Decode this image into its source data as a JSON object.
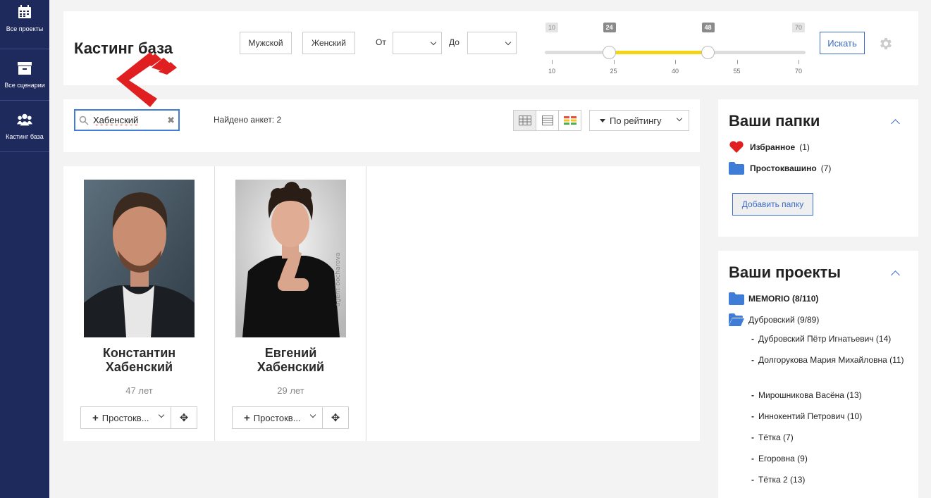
{
  "sidebar": {
    "items": [
      {
        "label": "Все проекты",
        "icon": "calendar-icon"
      },
      {
        "label": "Все сценарии",
        "icon": "archive-icon"
      },
      {
        "label": "Кастинг база",
        "icon": "users-icon"
      }
    ]
  },
  "header": {
    "title": "Кастинг база",
    "male_label": "Мужской",
    "female_label": "Женский",
    "from_label": "От",
    "to_label": "До",
    "search_label": "Искать"
  },
  "age_slider": {
    "min": 10,
    "max": 70,
    "low": 24,
    "high": 48,
    "min_label": "10",
    "max_label": "70",
    "low_label": "24",
    "high_label": "48",
    "ticks": [
      "10",
      "25",
      "40",
      "55",
      "70"
    ]
  },
  "filter": {
    "search_value": "Хабенский",
    "found_text": "Найдено анкет: 2",
    "sort_label": "По рейтингу"
  },
  "cards": [
    {
      "first": "Константин",
      "last": "Хабенский",
      "age": "47 лет",
      "folder": "Простоквашино",
      "folder_short": "Простоквашино",
      "folder_display": "Простокв..."
    },
    {
      "first": "Евгений",
      "last": "Хабенский",
      "age": "29 лет",
      "folder": "Простоквашино",
      "folder_display": "Простокв..."
    }
  ],
  "folders_panel": {
    "title": "Ваши папки",
    "items": [
      {
        "name": "Избранное",
        "count": "(1)",
        "icon": "heart-icon"
      },
      {
        "name": "Простоквашино",
        "count": "(7)",
        "icon": "folder-icon"
      }
    ],
    "add_label": "Добавить папку"
  },
  "projects_panel": {
    "title": "Ваши проекты",
    "projects": [
      {
        "label": "MEMORIO (8/110)"
      },
      {
        "label": "Дубровский (9/89)"
      }
    ],
    "roles": [
      "Дубровский Пётр Игнатьевич (14)",
      "Долгорукова Мария Михайловна (11)",
      "Мирошникова Васёна (13)",
      "Иннокентий Петрович (10)",
      "Тётка (7)",
      "Егоровна (9)",
      "Тётка 2 (13)"
    ]
  },
  "colors": {
    "sidebar": "#1f2a5c",
    "accent": "#3b6cc7",
    "slider_fill": "#f5d316",
    "arrow": "#e02020"
  }
}
